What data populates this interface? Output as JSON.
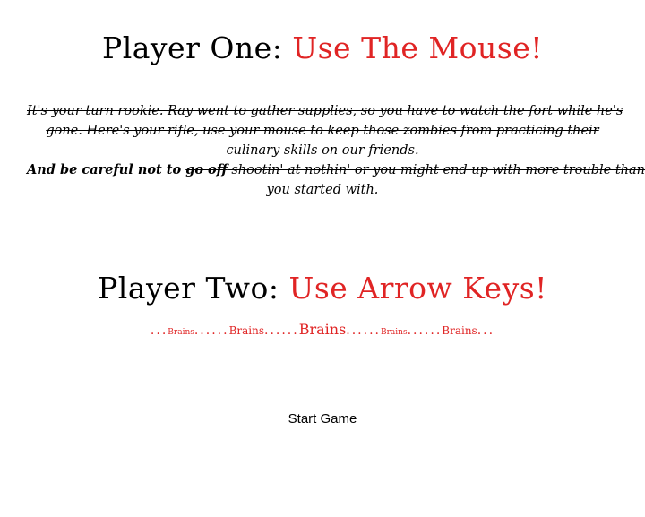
{
  "player_one": {
    "label": "Player One:",
    "action": "Use The Mouse!"
  },
  "instructions": {
    "line1_a": "It's your turn rookie. Ray went to gather supplies, so you have to watch the fort while he's",
    "line2_a": "gone. Here's your rifle, use your mouse to keep those zombies from practicing their",
    "line3_a": "culinary skills on our friends.",
    "line4_a": "And be careful not to ",
    "line4_b": "go off",
    "line4_c": " shootin' at nothin' or you might end up with more trouble than",
    "line5_a": "you started with."
  },
  "player_two": {
    "label": "Player Two:",
    "action": "Use Arrow Keys!"
  },
  "brains": {
    "dots1": "...",
    "w1": "Brains",
    "dots2": "......",
    "w2": "Brains",
    "dots3": "......",
    "w3": "Brains",
    "dots4": "......",
    "w4": "Brains",
    "dots5": "......",
    "w5": "Brains",
    "dots6": "..."
  },
  "start_button": "Start Game",
  "colors": {
    "accent": "#e02424",
    "text": "#000000",
    "background": "#ffffff"
  }
}
